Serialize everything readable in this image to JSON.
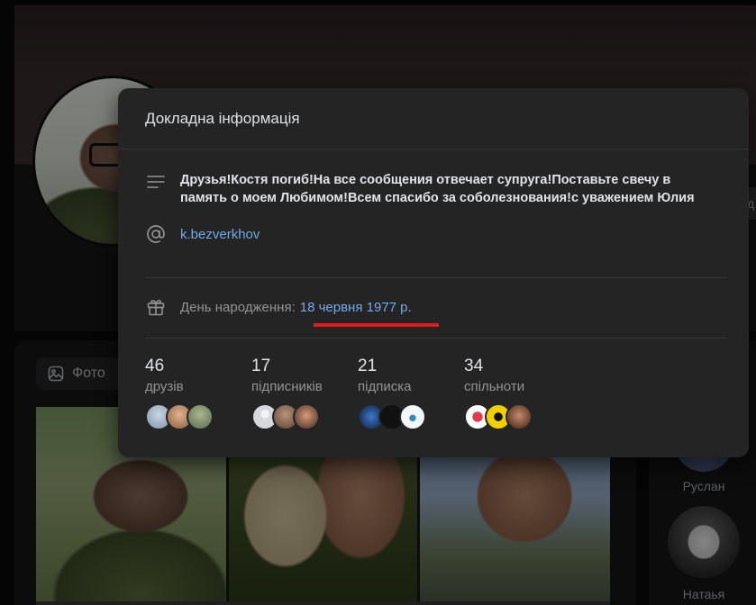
{
  "background": {
    "photos_tab_label": "Фото",
    "friends": [
      {
        "name": "Руслан"
      },
      {
        "name": "Натаья"
      }
    ],
    "right_button_char": "д"
  },
  "popup": {
    "title": "Докладна інформація",
    "about": "Друзья!Костя погиб!На все сообщения отвечает супруга!Поставьте свечу в память о моем Любимом!Всем спасибо за соболезнования!с уважением Юлия",
    "nickname": "k.bezverkhov",
    "birthday_label": "День народження:",
    "birthday_value": "18 червня 1977 р.",
    "annotation_color": "#e11b1b",
    "stats": [
      {
        "value": "46",
        "label": "друзів",
        "avatars": [
          "#9fb3c8",
          "#c9a07a",
          "#7e8f6e"
        ]
      },
      {
        "value": "17",
        "label": "підписників",
        "avatars": [
          "#d5d8dc",
          "#8a6d5c",
          "#b0704f"
        ]
      },
      {
        "value": "21",
        "label": "підписка",
        "avatars": [
          "#2b5fa8",
          "#111111",
          "#e9f2f7"
        ]
      },
      {
        "value": "34",
        "label": "спільноти",
        "avatars": [
          "#ffffff",
          "#f2d000",
          "#6b3b2e"
        ]
      }
    ]
  },
  "colors": {
    "link": "#71aaeb",
    "panel": "#242424",
    "muted_text": "#939393"
  }
}
